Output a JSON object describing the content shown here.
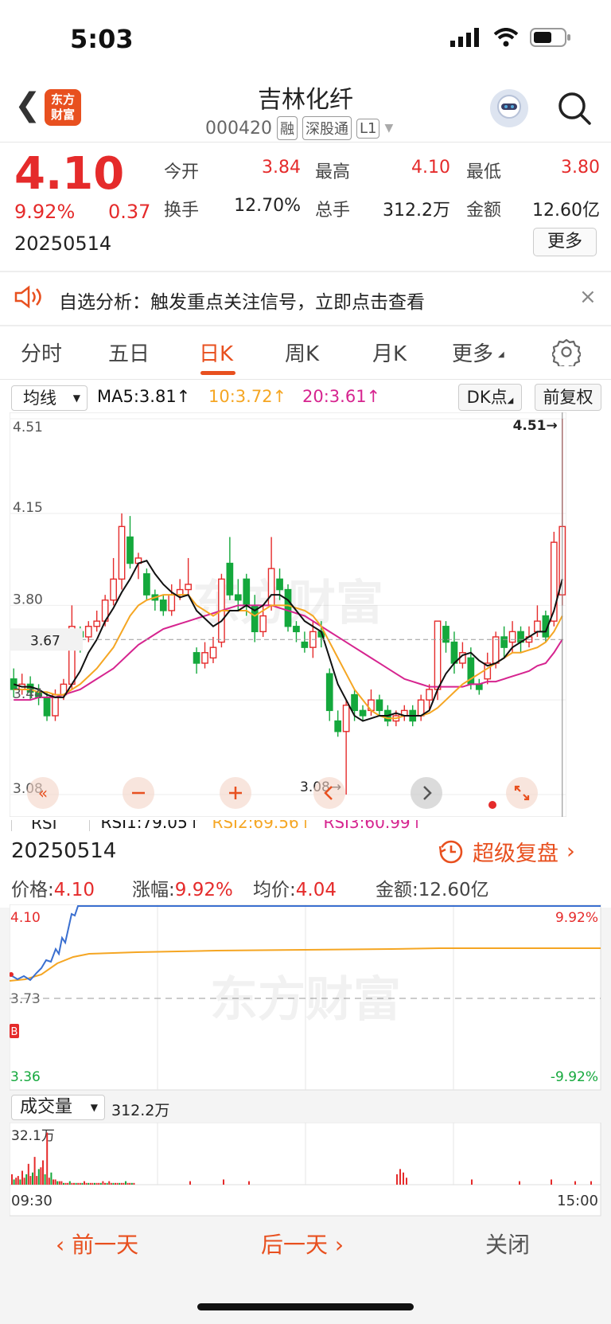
{
  "status": {
    "time": "5:03"
  },
  "header": {
    "name": "吉林化纤",
    "code": "000420",
    "tags": [
      "融",
      "深股通",
      "L1"
    ],
    "logo_text": "东方财富"
  },
  "quote": {
    "price": "4.10",
    "pct": "9.92%",
    "change": "0.37",
    "date": "20250514",
    "open_label": "今开",
    "open": "3.84",
    "high_label": "最高",
    "high": "4.10",
    "low_label": "最低",
    "low": "3.80",
    "turnover_label": "换手",
    "turnover": "12.70%",
    "volume_label": "总手",
    "volume": "312.2万",
    "amount_label": "金额",
    "amount": "12.60亿",
    "more_label": "更多"
  },
  "notice": {
    "text": "自选分析：触发重点关注信号，立即点击查看",
    "close": "×"
  },
  "tabs": [
    "分时",
    "五日",
    "日K",
    "周K",
    "月K",
    "更多"
  ],
  "active_tab": "日K",
  "kline": {
    "indicator_select": "均线",
    "ma5": "MA5:3.81↑",
    "ma10": "10:3.72↑",
    "ma20": "20:3.61↑",
    "dk_label": "DK点",
    "adjust_label": "前复权",
    "y_labels": [
      "4.51",
      "4.15",
      "3.80",
      "3.44",
      "3.08"
    ],
    "current_price_label": "3.67",
    "max_marker": "4.51→",
    "min_marker": "3.08→",
    "colors": {
      "up": "#e52b2b",
      "down": "#14a83c",
      "ma5": "#111111",
      "ma10": "#f5a623",
      "ma20": "#d6248f"
    }
  },
  "chart_data": {
    "type": "candlestick",
    "ylim": [
      3.08,
      4.51
    ],
    "y_ticks": [
      4.51,
      4.15,
      3.8,
      3.44,
      3.08
    ],
    "candles": [
      [
        3.52,
        3.48,
        3.56,
        3.45
      ],
      [
        3.48,
        3.5,
        3.54,
        3.46
      ],
      [
        3.5,
        3.47,
        3.53,
        3.44
      ],
      [
        3.47,
        3.45,
        3.5,
        3.42
      ],
      [
        3.45,
        3.38,
        3.47,
        3.36
      ],
      [
        3.38,
        3.46,
        3.48,
        3.36
      ],
      [
        3.46,
        3.5,
        3.52,
        3.44
      ],
      [
        3.5,
        3.72,
        3.8,
        3.48
      ],
      [
        3.7,
        3.68,
        3.72,
        3.62
      ],
      [
        3.68,
        3.72,
        3.74,
        3.66
      ],
      [
        3.72,
        3.74,
        3.78,
        3.7
      ],
      [
        3.74,
        3.82,
        3.84,
        3.72
      ],
      [
        3.82,
        3.9,
        3.98,
        3.8
      ],
      [
        3.9,
        4.1,
        4.15,
        3.86
      ],
      [
        4.06,
        3.96,
        4.14,
        3.94
      ],
      [
        3.96,
        3.98,
        4.0,
        3.9
      ],
      [
        3.92,
        3.84,
        3.94,
        3.82
      ],
      [
        3.84,
        3.82,
        3.86,
        3.78
      ],
      [
        3.82,
        3.78,
        3.84,
        3.76
      ],
      [
        3.78,
        3.84,
        3.88,
        3.76
      ],
      [
        3.84,
        3.86,
        3.9,
        3.82
      ],
      [
        3.86,
        3.88,
        3.98,
        3.84
      ],
      [
        3.62,
        3.58,
        3.64,
        3.54
      ],
      [
        3.58,
        3.62,
        3.66,
        3.56
      ],
      [
        3.6,
        3.64,
        3.68,
        3.58
      ],
      [
        3.66,
        3.9,
        3.92,
        3.64
      ],
      [
        3.96,
        3.84,
        4.06,
        3.82
      ],
      [
        3.84,
        3.82,
        3.9,
        3.78
      ],
      [
        3.9,
        3.8,
        3.92,
        3.76
      ],
      [
        3.8,
        3.7,
        3.84,
        3.66
      ],
      [
        3.7,
        3.76,
        3.8,
        3.68
      ],
      [
        3.8,
        3.94,
        4.06,
        3.78
      ],
      [
        3.9,
        3.86,
        3.94,
        3.82
      ],
      [
        3.86,
        3.72,
        3.88,
        3.7
      ],
      [
        3.72,
        3.7,
        3.74,
        3.66
      ],
      [
        3.66,
        3.64,
        3.7,
        3.62
      ],
      [
        3.64,
        3.7,
        3.74,
        3.6
      ],
      [
        3.7,
        3.68,
        3.74,
        3.64
      ],
      [
        3.54,
        3.4,
        3.56,
        3.36
      ],
      [
        3.36,
        3.32,
        3.4,
        3.3
      ],
      [
        3.32,
        3.42,
        3.44,
        3.08
      ],
      [
        3.46,
        3.4,
        3.48,
        3.36
      ],
      [
        3.4,
        3.38,
        3.42,
        3.36
      ],
      [
        3.4,
        3.44,
        3.48,
        3.38
      ],
      [
        3.44,
        3.4,
        3.46,
        3.38
      ],
      [
        3.4,
        3.36,
        3.42,
        3.34
      ],
      [
        3.36,
        3.38,
        3.4,
        3.34
      ],
      [
        3.38,
        3.4,
        3.42,
        3.36
      ],
      [
        3.4,
        3.36,
        3.42,
        3.34
      ],
      [
        3.38,
        3.44,
        3.46,
        3.36
      ],
      [
        3.44,
        3.48,
        3.5,
        3.4
      ],
      [
        3.48,
        3.74,
        3.74,
        3.44
      ],
      [
        3.72,
        3.66,
        3.74,
        3.62
      ],
      [
        3.66,
        3.58,
        3.7,
        3.54
      ],
      [
        3.58,
        3.62,
        3.66,
        3.56
      ],
      [
        3.6,
        3.5,
        3.64,
        3.48
      ],
      [
        3.5,
        3.48,
        3.52,
        3.46
      ],
      [
        3.52,
        3.58,
        3.62,
        3.5
      ],
      [
        3.58,
        3.68,
        3.7,
        3.56
      ],
      [
        3.68,
        3.64,
        3.72,
        3.6
      ],
      [
        3.66,
        3.7,
        3.74,
        3.62
      ],
      [
        3.7,
        3.66,
        3.72,
        3.62
      ],
      [
        3.66,
        3.68,
        3.72,
        3.64
      ],
      [
        3.7,
        3.74,
        3.8,
        3.68
      ],
      [
        3.76,
        3.68,
        3.78,
        3.66
      ],
      [
        3.74,
        4.04,
        4.08,
        3.72
      ],
      [
        3.84,
        4.1,
        4.51,
        3.8
      ]
    ],
    "ma5": [
      3.5,
      3.49,
      3.49,
      3.48,
      3.46,
      3.45,
      3.45,
      3.5,
      3.55,
      3.62,
      3.67,
      3.74,
      3.79,
      3.85,
      3.9,
      3.96,
      3.97,
      3.92,
      3.88,
      3.85,
      3.83,
      3.84,
      3.78,
      3.75,
      3.72,
      3.74,
      3.78,
      3.78,
      3.8,
      3.78,
      3.8,
      3.84,
      3.84,
      3.82,
      3.78,
      3.74,
      3.72,
      3.7,
      3.6,
      3.5,
      3.44,
      3.38,
      3.36,
      3.37,
      3.38,
      3.38,
      3.39,
      3.38,
      3.38,
      3.38,
      3.4,
      3.48,
      3.54,
      3.58,
      3.61,
      3.62,
      3.59,
      3.57,
      3.58,
      3.6,
      3.64,
      3.66,
      3.68,
      3.7,
      3.7,
      3.78,
      3.9
    ],
    "ma10": [
      3.48,
      3.48,
      3.48,
      3.47,
      3.47,
      3.46,
      3.46,
      3.48,
      3.5,
      3.53,
      3.56,
      3.6,
      3.64,
      3.7,
      3.76,
      3.8,
      3.82,
      3.83,
      3.84,
      3.84,
      3.84,
      3.84,
      3.8,
      3.78,
      3.76,
      3.78,
      3.78,
      3.78,
      3.78,
      3.76,
      3.78,
      3.8,
      3.8,
      3.8,
      3.79,
      3.78,
      3.76,
      3.72,
      3.66,
      3.6,
      3.54,
      3.48,
      3.44,
      3.4,
      3.38,
      3.37,
      3.37,
      3.38,
      3.38,
      3.38,
      3.39,
      3.41,
      3.44,
      3.47,
      3.5,
      3.52,
      3.54,
      3.56,
      3.58,
      3.6,
      3.62,
      3.62,
      3.63,
      3.64,
      3.66,
      3.7,
      3.76
    ],
    "ma20": [
      3.44,
      3.44,
      3.44,
      3.45,
      3.45,
      3.45,
      3.46,
      3.47,
      3.48,
      3.5,
      3.52,
      3.54,
      3.56,
      3.59,
      3.62,
      3.65,
      3.67,
      3.69,
      3.71,
      3.72,
      3.73,
      3.74,
      3.75,
      3.76,
      3.77,
      3.78,
      3.79,
      3.8,
      3.8,
      3.8,
      3.8,
      3.8,
      3.79,
      3.78,
      3.77,
      3.76,
      3.74,
      3.72,
      3.7,
      3.68,
      3.66,
      3.64,
      3.62,
      3.6,
      3.58,
      3.56,
      3.54,
      3.52,
      3.51,
      3.5,
      3.49,
      3.49,
      3.49,
      3.49,
      3.49,
      3.5,
      3.5,
      3.51,
      3.51,
      3.52,
      3.53,
      3.54,
      3.55,
      3.57,
      3.58,
      3.62,
      3.67
    ]
  },
  "rsi_row": {
    "select": "RSI",
    "rsi1": "RSI1:79.05↑",
    "rsi2": "RSI2:69.56↑",
    "rsi3": "RSI3:60.99↑"
  },
  "intraday": {
    "date": "20250514",
    "replay_label": "超级复盘",
    "price_label": "价格:",
    "price": "4.10",
    "pct_label": "涨幅:",
    "pct": "9.92%",
    "avg_label": "均价:",
    "avg": "4.04",
    "amount_label": "金额:",
    "amount": "12.60亿",
    "top_left": "4.10",
    "mid_left": "3.73",
    "bottom_left": "3.36",
    "top_right": "9.92%",
    "bottom_right": "-9.92%",
    "b_marker": "B",
    "volume_select": "成交量",
    "volume_value": "312.2万",
    "volume_max": "32.1万",
    "time_start": "09:30",
    "time_end": "15:00"
  },
  "bottom": {
    "prev": "前一天",
    "next": "后一天",
    "close": "关闭"
  },
  "watermark": "东方财富"
}
